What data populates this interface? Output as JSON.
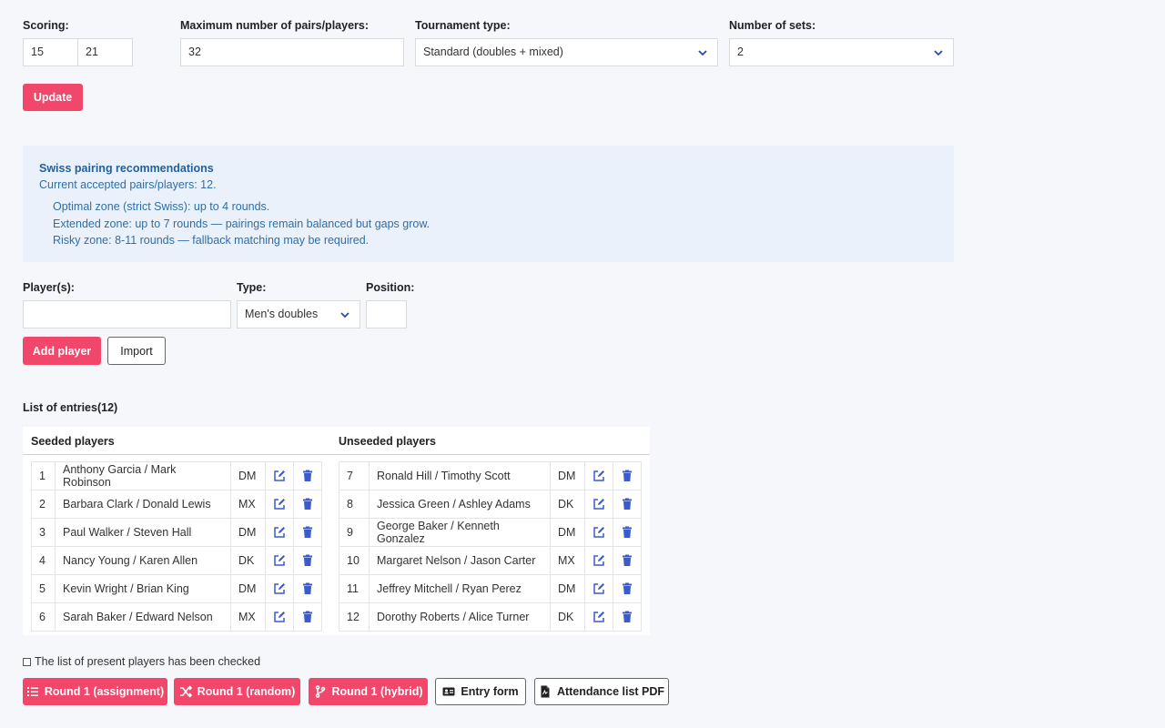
{
  "settings": {
    "scoring_label": "Scoring:",
    "scoring_a": "15",
    "scoring_b": "21",
    "max_label": "Maximum number of pairs/players:",
    "max_value": "32",
    "type_label": "Tournament type:",
    "type_value": "Standard (doubles + mixed)",
    "sets_label": "Number of sets:",
    "sets_value": "2",
    "update_button": "Update"
  },
  "swiss": {
    "title": "Swiss pairing recommendations",
    "current": "Current accepted pairs/players: 12.",
    "lines": [
      "Optimal zone (strict Swiss): up to 4 rounds.",
      "Extended zone: up to 7 rounds — pairings remain balanced but gaps grow.",
      "Risky zone: 8-11 rounds — fallback matching may be required."
    ]
  },
  "add": {
    "players_label": "Player(s):",
    "players_value": "",
    "type_label": "Type:",
    "type_value": "Men's doubles",
    "position_label": "Position:",
    "position_value": "",
    "add_button": "Add player",
    "import_button": "Import"
  },
  "entries": {
    "title": "List of entries(12)",
    "seeded_header": "Seeded players",
    "unseeded_header": "Unseeded players",
    "seeded": [
      {
        "pos": "1",
        "name": "Anthony Garcia / Mark Robinson",
        "type": "DM"
      },
      {
        "pos": "2",
        "name": "Barbara Clark / Donald Lewis",
        "type": "MX"
      },
      {
        "pos": "3",
        "name": "Paul Walker / Steven Hall",
        "type": "DM"
      },
      {
        "pos": "4",
        "name": "Nancy Young / Karen Allen",
        "type": "DK"
      },
      {
        "pos": "5",
        "name": "Kevin Wright / Brian King",
        "type": "DM"
      },
      {
        "pos": "6",
        "name": "Sarah Baker / Edward Nelson",
        "type": "MX"
      }
    ],
    "unseeded": [
      {
        "pos": "7",
        "name": "Ronald Hill / Timothy Scott",
        "type": "DM"
      },
      {
        "pos": "8",
        "name": "Jessica Green / Ashley Adams",
        "type": "DK"
      },
      {
        "pos": "9",
        "name": "George Baker / Kenneth Gonzalez",
        "type": "DM"
      },
      {
        "pos": "10",
        "name": "Margaret Nelson / Jason Carter",
        "type": "MX"
      },
      {
        "pos": "11",
        "name": "Jeffrey Mitchell / Ryan Perez",
        "type": "DM"
      },
      {
        "pos": "12",
        "name": "Dorothy Roberts / Alice Turner",
        "type": "DK"
      }
    ]
  },
  "footer": {
    "checkbox_label": "The list of present players has been checked",
    "round_assignment": "Round 1 (assignment)",
    "round_random": "Round 1 (random)",
    "round_hybrid": "Round 1 (hybrid)",
    "entry_form": "Entry form",
    "attendance_pdf": "Attendance list PDF"
  },
  "colors": {
    "accent": "#f0476b",
    "icon": "#3b5bcc",
    "info_bg": "#eaf1fb",
    "info_text": "#2f6ea8"
  },
  "icons": [
    "chevron-down-icon",
    "edit-icon",
    "trash-icon",
    "list-ordered-icon",
    "shuffle-icon",
    "git-branch-icon",
    "id-card-icon",
    "pdf-file-icon"
  ]
}
